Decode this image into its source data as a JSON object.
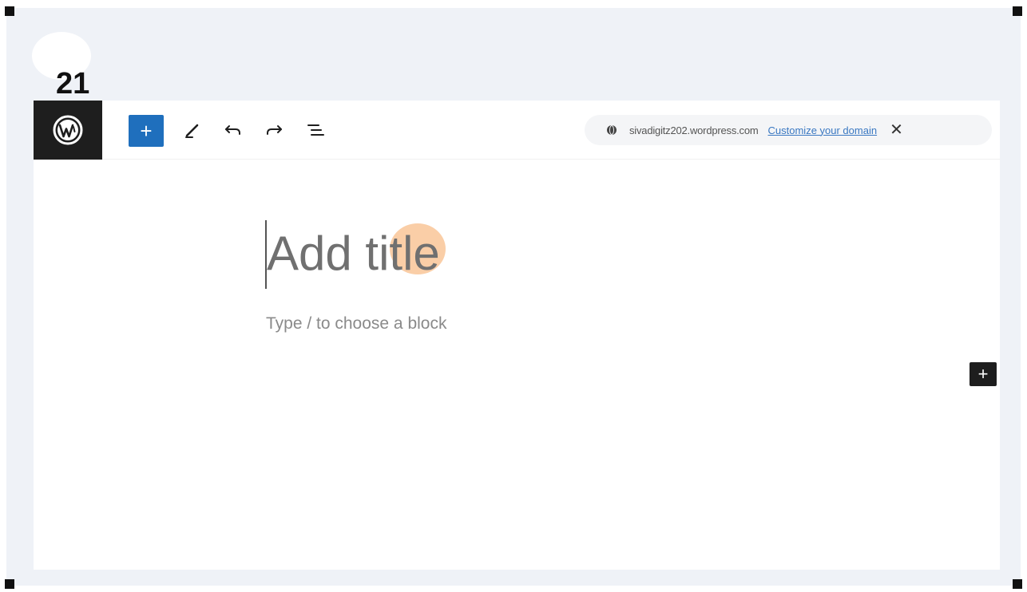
{
  "step": {
    "number": "21"
  },
  "toolbar": {
    "inserter_label": "+",
    "icons": {
      "logo": "wordpress-logo-icon",
      "edit": "pencil-icon",
      "undo": "undo-icon",
      "redo": "redo-icon",
      "list_view": "list-view-icon"
    }
  },
  "domain_bar": {
    "icon": "globe-icon",
    "site_url": "sivadigitz202.wordpress.com",
    "customize_link": "Customize your domain",
    "close_label": "✕"
  },
  "editor": {
    "title_placeholder": "Add title",
    "block_hint": "Type / to choose a block",
    "side_add_label": "+"
  },
  "colors": {
    "accent": "#1f6fbd",
    "dark": "#1e1e1e",
    "link": "#3a78c2",
    "click_highlight": "#f5a65f",
    "frame_background": "#eff2f7"
  }
}
